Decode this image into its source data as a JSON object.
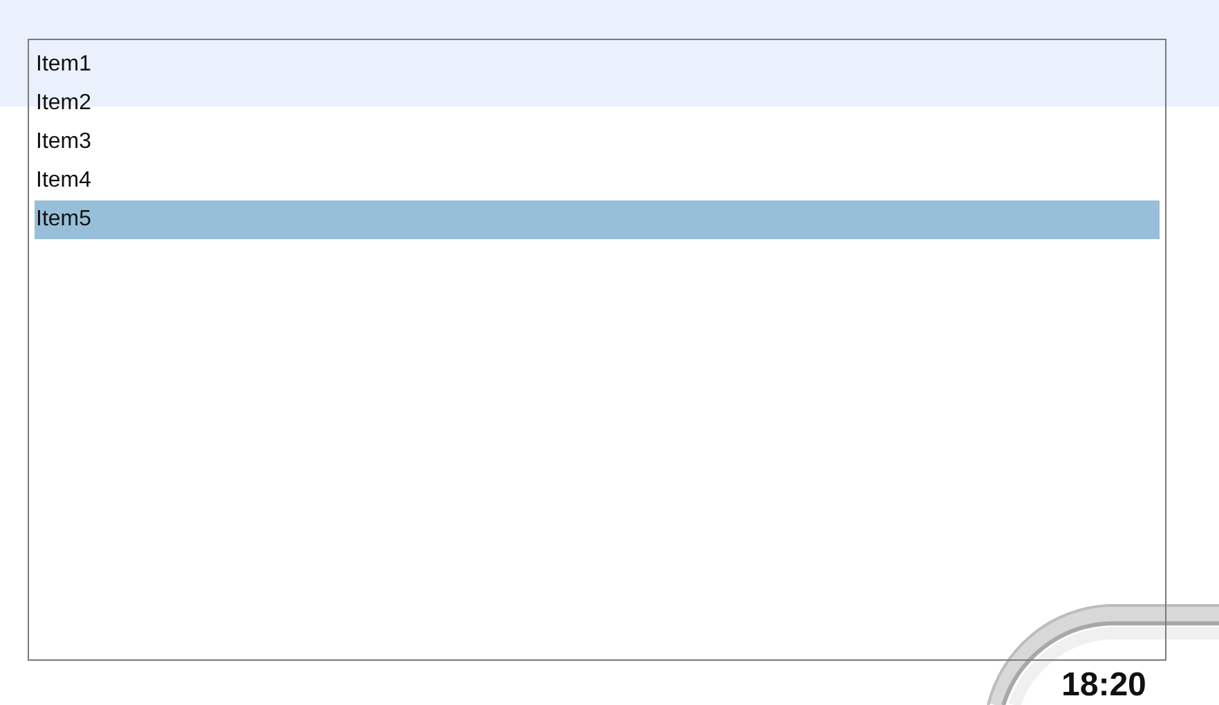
{
  "list": {
    "items": [
      {
        "label": "Item1",
        "selected": false
      },
      {
        "label": "Item2",
        "selected": false
      },
      {
        "label": "Item3",
        "selected": false
      },
      {
        "label": "Item4",
        "selected": false
      },
      {
        "label": "Item5",
        "selected": true
      }
    ]
  },
  "clock": {
    "time": "18:20"
  }
}
